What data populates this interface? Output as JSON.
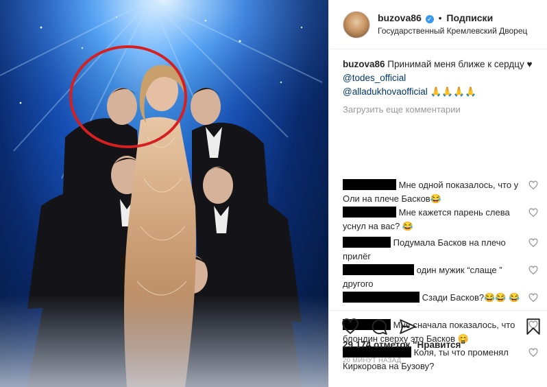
{
  "post": {
    "username": "buzova86",
    "verified_mark": "✓",
    "separator": "•",
    "follow_label": "Подписки",
    "location": "Государственный Кремлевский Дворец"
  },
  "caption": {
    "username": "buzova86",
    "text_before": "Принимай меня ближе к сердцу",
    "heart": "♥",
    "mention1": "@todes_official",
    "mention2": "@alladukhova",
    "mention2_tail": "official",
    "emojis": "🙏🙏🙏🙏"
  },
  "load_more_label": "Загрузить еще комментарии",
  "comments": [
    {
      "redact_width": 78,
      "text": "Мне одной показалось, что у Оли на плече Басков😂"
    },
    {
      "redact_width": 78,
      "text": "Мне кажется парень слева уснул на вас? 😂"
    },
    {
      "redact_width": 70,
      "text": "Подумала Басков на плечо прилёг"
    },
    {
      "redact_width": 104,
      "text": "один мужик “слаще ” другого"
    },
    {
      "redact_width": 112,
      "text": "Сзади Басков?😂😂 😂"
    },
    {
      "redact_width": 70,
      "text": "Мне сначала показалось, что блондин сверху это Басков 😊"
    },
    {
      "redact_width": 100,
      "text": "Коля, ты что променял Киркорова на Бузову?"
    }
  ],
  "likes_label": "29 174 отметок \"Нравится\"",
  "time_label": "20 МИНУТ НАЗАД",
  "icons": [
    "like-icon",
    "comment-icon",
    "share-icon",
    "bookmark-icon",
    "verified-icon",
    "heart-icon"
  ],
  "colors": {
    "mention": "#003569",
    "verified": "#3897f0",
    "muted": "#999999",
    "highlight_circle": "#d42020"
  }
}
